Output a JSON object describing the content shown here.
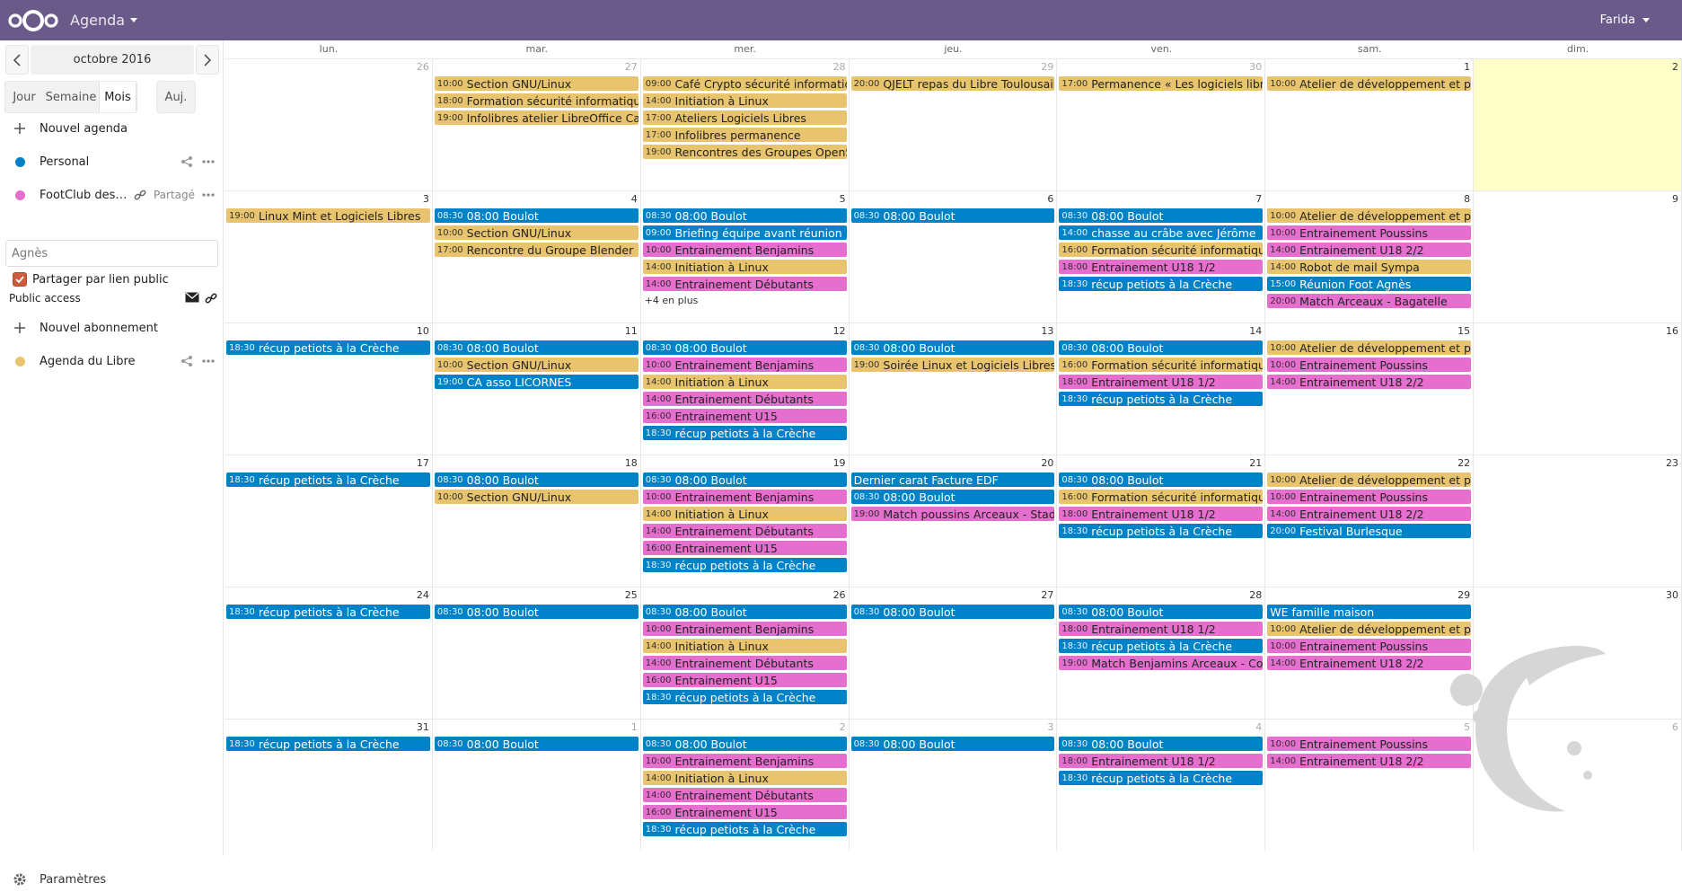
{
  "header": {
    "app_name": "Agenda",
    "user": "Farida"
  },
  "sidebar": {
    "date_label": "octobre 2016",
    "views": {
      "day": "Jour",
      "week": "Semaine",
      "month": "Mois",
      "today": "Auj."
    },
    "new_calendar": "Nouvel agenda",
    "calendars": [
      {
        "name": "Personal",
        "color": "#0082c9"
      },
      {
        "name": "FootClub des…",
        "color": "#e66ece",
        "shared_label": "Partagé"
      }
    ],
    "share_placeholder": "Agnès",
    "share_public_label": "Partager par lien public",
    "public_access": "Public access",
    "new_subscription": "Nouvel abonnement",
    "subscriptions": [
      {
        "name": "Agenda du Libre",
        "color": "#e8c46e"
      }
    ],
    "settings": "Paramètres"
  },
  "calendar": {
    "weekdays": [
      "lun.",
      "mar.",
      "mer.",
      "jeu.",
      "ven.",
      "sam.",
      "dim."
    ],
    "weeks": [
      [
        {
          "num": "26",
          "other": true,
          "events": []
        },
        {
          "num": "27",
          "other": true,
          "events": [
            {
              "time": "10:00",
              "title": "Section GNU/Linux",
              "color": "yellow"
            },
            {
              "time": "18:00",
              "title": "Formation sécurité informatique",
              "color": "yellow"
            },
            {
              "time": "19:00",
              "title": "Infolibres atelier LibreOffice Calc",
              "color": "yellow"
            }
          ]
        },
        {
          "num": "28",
          "other": true,
          "events": [
            {
              "time": "09:00",
              "title": "Café Crypto sécurité informatique",
              "color": "yellow"
            },
            {
              "time": "14:00",
              "title": "Initiation à Linux",
              "color": "yellow"
            },
            {
              "time": "17:00",
              "title": "Ateliers Logiciels Libres",
              "color": "yellow"
            },
            {
              "time": "17:00",
              "title": "Infolibres permanence",
              "color": "yellow"
            },
            {
              "time": "19:00",
              "title": "Rencontres des Groupes OpenStreetMap",
              "color": "yellow"
            }
          ]
        },
        {
          "num": "29",
          "other": true,
          "events": [
            {
              "time": "20:00",
              "title": "QJELT repas du Libre Toulousain",
              "color": "yellow"
            }
          ]
        },
        {
          "num": "30",
          "other": true,
          "events": [
            {
              "time": "17:00",
              "title": "Permanence « Les logiciels libres »",
              "color": "yellow"
            }
          ]
        },
        {
          "num": "1",
          "events": [
            {
              "time": "10:00",
              "title": "Atelier de développement et programmation",
              "color": "yellow"
            }
          ]
        },
        {
          "num": "2",
          "today": true,
          "events": []
        }
      ],
      [
        {
          "num": "3",
          "events": [
            {
              "time": "19:00",
              "title": "Linux Mint et Logiciels Libres",
              "color": "yellow"
            }
          ]
        },
        {
          "num": "4",
          "events": [
            {
              "time": "08:30",
              "title": "08:00 Boulot",
              "color": "blue"
            },
            {
              "time": "10:00",
              "title": "Section GNU/Linux",
              "color": "yellow"
            },
            {
              "time": "17:00",
              "title": "Rencontre du Groupe Blender",
              "color": "yellow"
            }
          ]
        },
        {
          "num": "5",
          "more": "+4 en plus",
          "events": [
            {
              "time": "08:30",
              "title": "08:00 Boulot",
              "color": "blue"
            },
            {
              "time": "09:00",
              "title": "Briefing équipe avant réunion",
              "color": "blue"
            },
            {
              "time": "10:00",
              "title": "Entrainement Benjamins",
              "color": "pink"
            },
            {
              "time": "14:00",
              "title": "Initiation à Linux",
              "color": "yellow"
            },
            {
              "time": "14:00",
              "title": "Entrainement Débutants",
              "color": "pink"
            }
          ]
        },
        {
          "num": "6",
          "events": [
            {
              "time": "08:30",
              "title": "08:00 Boulot",
              "color": "blue"
            }
          ]
        },
        {
          "num": "7",
          "events": [
            {
              "time": "08:30",
              "title": "08:00 Boulot",
              "color": "blue"
            },
            {
              "time": "14:00",
              "title": "chasse au crâbe avec Jérôme",
              "color": "blue"
            },
            {
              "time": "16:00",
              "title": "Formation sécurité informatique",
              "color": "yellow"
            },
            {
              "time": "18:00",
              "title": "Entrainement U18 1/2",
              "color": "pink"
            },
            {
              "time": "18:30",
              "title": "récup petiots à la Crèche",
              "color": "blue"
            }
          ]
        },
        {
          "num": "8",
          "events": [
            {
              "time": "10:00",
              "title": "Atelier de développement et programmation",
              "color": "yellow"
            },
            {
              "time": "10:00",
              "title": "Entrainement Poussins",
              "color": "pink"
            },
            {
              "time": "14:00",
              "title": "Entrainement U18 2/2",
              "color": "pink"
            },
            {
              "time": "14:00",
              "title": "Robot de mail Sympa",
              "color": "yellow"
            },
            {
              "time": "15:00",
              "title": "Réunion Foot Agnès",
              "color": "blue"
            },
            {
              "time": "20:00",
              "title": "Match Arceaux - Bagatelle",
              "color": "pink"
            }
          ]
        },
        {
          "num": "9",
          "events": []
        }
      ],
      [
        {
          "num": "10",
          "events": [
            {
              "time": "18:30",
              "title": "récup petiots à la Crèche",
              "color": "blue"
            }
          ]
        },
        {
          "num": "11",
          "events": [
            {
              "time": "08:30",
              "title": "08:00 Boulot",
              "color": "blue"
            },
            {
              "time": "10:00",
              "title": "Section GNU/Linux",
              "color": "yellow"
            },
            {
              "time": "19:00",
              "title": "CA asso LICORNES",
              "color": "blue"
            }
          ]
        },
        {
          "num": "12",
          "events": [
            {
              "time": "08:30",
              "title": "08:00 Boulot",
              "color": "blue"
            },
            {
              "time": "10:00",
              "title": "Entrainement Benjamins",
              "color": "pink"
            },
            {
              "time": "14:00",
              "title": "Initiation à Linux",
              "color": "yellow"
            },
            {
              "time": "14:00",
              "title": "Entrainement Débutants",
              "color": "pink"
            },
            {
              "time": "16:00",
              "title": "Entrainement U15",
              "color": "pink"
            },
            {
              "time": "18:30",
              "title": "récup petiots à la Crèche",
              "color": "blue"
            }
          ]
        },
        {
          "num": "13",
          "events": [
            {
              "time": "08:30",
              "title": "08:00 Boulot",
              "color": "blue"
            },
            {
              "time": "19:00",
              "title": "Soirée Linux et Logiciels Libres",
              "color": "yellow"
            }
          ]
        },
        {
          "num": "14",
          "events": [
            {
              "time": "08:30",
              "title": "08:00 Boulot",
              "color": "blue"
            },
            {
              "time": "16:00",
              "title": "Formation sécurité informatique",
              "color": "yellow"
            },
            {
              "time": "18:00",
              "title": "Entrainement U18 1/2",
              "color": "pink"
            },
            {
              "time": "18:30",
              "title": "récup petiots à la Crèche",
              "color": "blue"
            }
          ]
        },
        {
          "num": "15",
          "events": [
            {
              "time": "10:00",
              "title": "Atelier de développement et programmation",
              "color": "yellow"
            },
            {
              "time": "10:00",
              "title": "Entrainement Poussins",
              "color": "pink"
            },
            {
              "time": "14:00",
              "title": "Entrainement U18 2/2",
              "color": "pink"
            }
          ]
        },
        {
          "num": "16",
          "events": []
        }
      ],
      [
        {
          "num": "17",
          "events": [
            {
              "time": "18:30",
              "title": "récup petiots à la Crèche",
              "color": "blue"
            }
          ]
        },
        {
          "num": "18",
          "events": [
            {
              "time": "08:30",
              "title": "08:00 Boulot",
              "color": "blue"
            },
            {
              "time": "10:00",
              "title": "Section GNU/Linux",
              "color": "yellow"
            }
          ]
        },
        {
          "num": "19",
          "events": [
            {
              "time": "08:30",
              "title": "08:00 Boulot",
              "color": "blue"
            },
            {
              "time": "10:00",
              "title": "Entrainement Benjamins",
              "color": "pink"
            },
            {
              "time": "14:00",
              "title": "Initiation à Linux",
              "color": "yellow"
            },
            {
              "time": "14:00",
              "title": "Entrainement Débutants",
              "color": "pink"
            },
            {
              "time": "16:00",
              "title": "Entrainement U15",
              "color": "pink"
            },
            {
              "time": "18:30",
              "title": "récup petiots à la Crèche",
              "color": "blue"
            }
          ]
        },
        {
          "num": "20",
          "events": [
            {
              "time": "",
              "title": "Dernier carat Facture EDF",
              "color": "blue"
            },
            {
              "time": "08:30",
              "title": "08:00 Boulot",
              "color": "blue"
            },
            {
              "time": "19:00",
              "title": "Match poussins Arceaux - Stade",
              "color": "pink"
            }
          ]
        },
        {
          "num": "21",
          "events": [
            {
              "time": "08:30",
              "title": "08:00 Boulot",
              "color": "blue"
            },
            {
              "time": "16:00",
              "title": "Formation sécurité informatique",
              "color": "yellow"
            },
            {
              "time": "18:00",
              "title": "Entrainement U18 1/2",
              "color": "pink"
            },
            {
              "time": "18:30",
              "title": "récup petiots à la Crèche",
              "color": "blue"
            }
          ]
        },
        {
          "num": "22",
          "events": [
            {
              "time": "10:00",
              "title": "Atelier de développement et programmation",
              "color": "yellow"
            },
            {
              "time": "10:00",
              "title": "Entrainement Poussins",
              "color": "pink"
            },
            {
              "time": "14:00",
              "title": "Entrainement U18 2/2",
              "color": "pink"
            },
            {
              "time": "20:00",
              "title": "Festival Burlesque",
              "color": "blue"
            }
          ]
        },
        {
          "num": "23",
          "events": []
        }
      ],
      [
        {
          "num": "24",
          "events": [
            {
              "time": "18:30",
              "title": "récup petiots à la Crèche",
              "color": "blue"
            }
          ]
        },
        {
          "num": "25",
          "events": [
            {
              "time": "08:30",
              "title": "08:00 Boulot",
              "color": "blue"
            }
          ]
        },
        {
          "num": "26",
          "events": [
            {
              "time": "08:30",
              "title": "08:00 Boulot",
              "color": "blue"
            },
            {
              "time": "10:00",
              "title": "Entrainement Benjamins",
              "color": "pink"
            },
            {
              "time": "14:00",
              "title": "Initiation à Linux",
              "color": "yellow"
            },
            {
              "time": "14:00",
              "title": "Entrainement Débutants",
              "color": "pink"
            },
            {
              "time": "16:00",
              "title": "Entrainement U15",
              "color": "pink"
            },
            {
              "time": "18:30",
              "title": "récup petiots à la Crèche",
              "color": "blue"
            }
          ]
        },
        {
          "num": "27",
          "events": [
            {
              "time": "08:30",
              "title": "08:00 Boulot",
              "color": "blue"
            }
          ]
        },
        {
          "num": "28",
          "events": [
            {
              "time": "08:30",
              "title": "08:00 Boulot",
              "color": "blue"
            },
            {
              "time": "18:00",
              "title": "Entrainement U18 1/2",
              "color": "pink"
            },
            {
              "time": "18:30",
              "title": "récup petiots à la Crèche",
              "color": "blue"
            },
            {
              "time": "19:00",
              "title": "Match Benjamins Arceaux - Colomiers",
              "color": "pink"
            }
          ]
        },
        {
          "num": "29",
          "events": [
            {
              "time": "",
              "title": "WE famille maison",
              "color": "blue"
            },
            {
              "time": "10:00",
              "title": "Atelier de développement et programmation",
              "color": "yellow"
            },
            {
              "time": "10:00",
              "title": "Entrainement Poussins",
              "color": "pink"
            },
            {
              "time": "14:00",
              "title": "Entrainement U18 2/2",
              "color": "pink"
            }
          ]
        },
        {
          "num": "30",
          "events": []
        }
      ],
      [
        {
          "num": "31",
          "events": [
            {
              "time": "18:30",
              "title": "récup petiots à la Crèche",
              "color": "blue"
            }
          ]
        },
        {
          "num": "1",
          "other": true,
          "events": [
            {
              "time": "08:30",
              "title": "08:00 Boulot",
              "color": "blue"
            }
          ]
        },
        {
          "num": "2",
          "other": true,
          "events": [
            {
              "time": "08:30",
              "title": "08:00 Boulot",
              "color": "blue"
            },
            {
              "time": "10:00",
              "title": "Entrainement Benjamins",
              "color": "pink"
            },
            {
              "time": "14:00",
              "title": "Initiation à Linux",
              "color": "yellow"
            },
            {
              "time": "14:00",
              "title": "Entrainement Débutants",
              "color": "pink"
            },
            {
              "time": "16:00",
              "title": "Entrainement U15",
              "color": "pink"
            },
            {
              "time": "18:30",
              "title": "récup petiots à la Crèche",
              "color": "blue"
            }
          ]
        },
        {
          "num": "3",
          "other": true,
          "events": [
            {
              "time": "08:30",
              "title": "08:00 Boulot",
              "color": "blue"
            }
          ]
        },
        {
          "num": "4",
          "other": true,
          "events": [
            {
              "time": "08:30",
              "title": "08:00 Boulot",
              "color": "blue"
            },
            {
              "time": "18:00",
              "title": "Entrainement U18 1/2",
              "color": "pink"
            },
            {
              "time": "18:30",
              "title": "récup petiots à la Crèche",
              "color": "blue"
            }
          ]
        },
        {
          "num": "5",
          "other": true,
          "events": [
            {
              "time": "10:00",
              "title": "Entrainement Poussins",
              "color": "pink"
            },
            {
              "time": "14:00",
              "title": "Entrainement U18 2/2",
              "color": "pink"
            }
          ]
        },
        {
          "num": "6",
          "other": true,
          "events": []
        }
      ]
    ]
  }
}
